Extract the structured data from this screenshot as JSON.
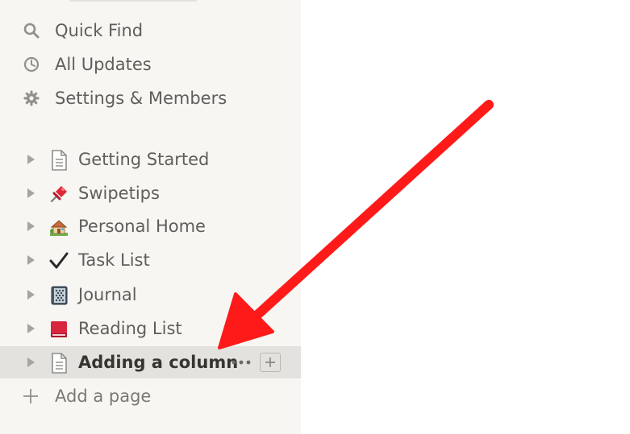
{
  "sidebar": {
    "nav": [
      {
        "label": "Quick Find",
        "icon": "search-icon"
      },
      {
        "label": "All Updates",
        "icon": "clock-icon"
      },
      {
        "label": "Settings & Members",
        "icon": "gear-icon"
      }
    ],
    "pages": [
      {
        "label": "Getting Started",
        "icon": "document-icon"
      },
      {
        "label": "Swipetips",
        "icon": "pushpin-icon"
      },
      {
        "label": "Personal Home",
        "icon": "house-icon"
      },
      {
        "label": "Task List",
        "icon": "checkmark-icon"
      },
      {
        "label": "Journal",
        "icon": "notebook-icon"
      },
      {
        "label": "Reading List",
        "icon": "book-icon"
      },
      {
        "label": "Adding a column",
        "icon": "document-icon",
        "selected": true
      }
    ],
    "add_page_label": "Add a page"
  },
  "colors": {
    "sidebar_bg": "#f7f6f3",
    "selected_bg": "#e3e2de",
    "text": "#5f5e5b",
    "annotation_arrow": "#ff1a1a"
  }
}
